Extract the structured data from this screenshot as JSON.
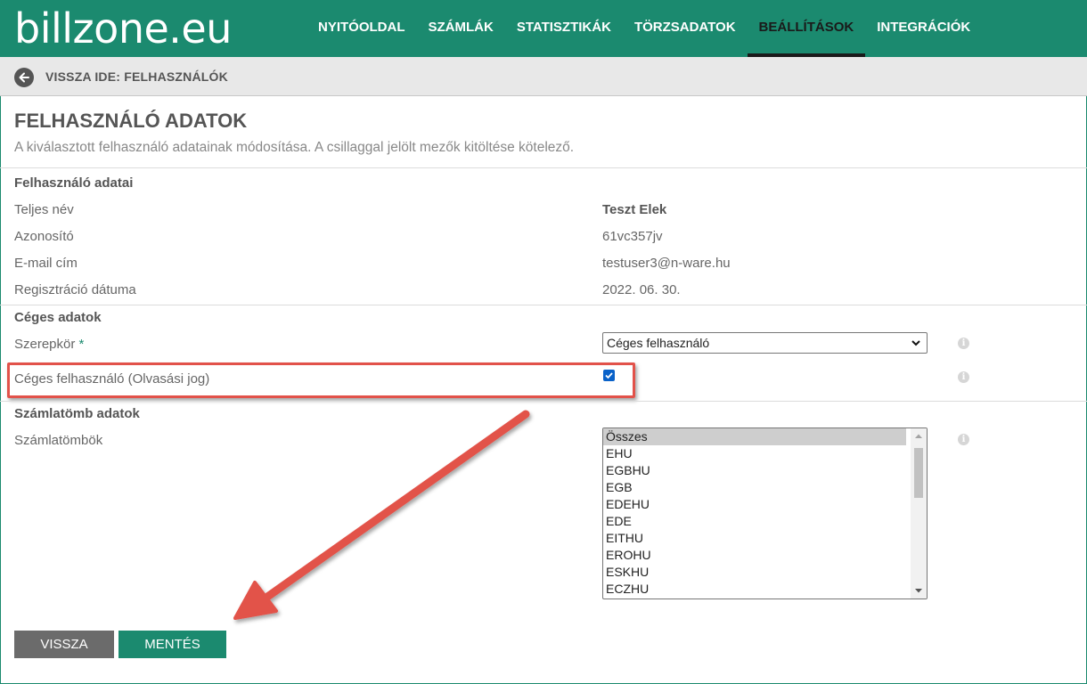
{
  "brand": {
    "logo": "billzone.eu",
    "color": "#1b8a6f"
  },
  "nav": {
    "items": [
      {
        "label": "NYITÓOLDAL"
      },
      {
        "label": "SZÁMLÁK"
      },
      {
        "label": "STATISZTIKÁK"
      },
      {
        "label": "TÖRZSADATOK"
      },
      {
        "label": "BEÁLLÍTÁSOK",
        "active": true
      },
      {
        "label": "INTEGRÁCIÓK"
      }
    ]
  },
  "backbar": {
    "label": "VISSZA IDE: FELHASZNÁLÓK",
    "icon": "arrow-left-icon"
  },
  "page": {
    "title": "FELHASZNÁLÓ ADATOK",
    "subtitle": "A kiválasztott felhasználó adatainak módosítása. A csillaggal jelölt mezők kitöltése kötelező."
  },
  "user_section": {
    "title": "Felhasználó adatai",
    "rows": [
      {
        "label": "Teljes név",
        "value": "Teszt Elek"
      },
      {
        "label": "Azonosító",
        "value": "61vc357jv"
      },
      {
        "label": "E-mail cím",
        "value": "testuser3@n-ware.hu"
      },
      {
        "label": "Regisztráció dátuma",
        "value": "2022. 06. 30."
      }
    ]
  },
  "company_section": {
    "title": "Céges adatok",
    "role_label": "Szerepkör",
    "required_mark": "*",
    "role_value": "Céges felhasználó",
    "readonly_label": "Céges felhasználó (Olvasási jog)",
    "readonly_checked": true,
    "info_icon": "info-icon"
  },
  "invoicebook_section": {
    "title": "Számlatömb adatok",
    "label": "Számlatömbök",
    "options": [
      "Összes",
      "EHU",
      "EGBHU",
      "EGB",
      "EDEHU",
      "EDE",
      "EITHU",
      "EROHU",
      "ESKHU",
      "ECZHU"
    ],
    "selected": "Összes"
  },
  "buttons": {
    "back": "VISSZA",
    "save": "MENTÉS"
  },
  "annotation": {
    "color": "#e2524a"
  }
}
